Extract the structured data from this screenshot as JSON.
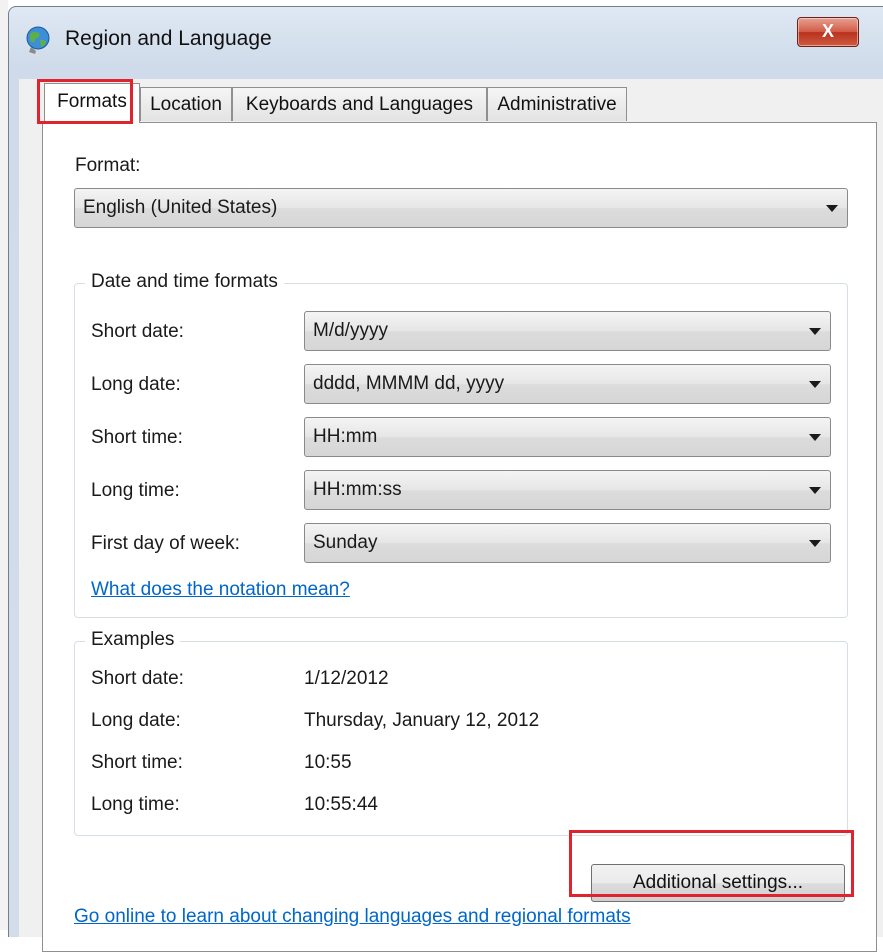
{
  "window": {
    "title": "Region and Language",
    "close_label": "X"
  },
  "tabs": [
    {
      "label": "Formats",
      "active": true
    },
    {
      "label": "Location"
    },
    {
      "label": "Keyboards and Languages"
    },
    {
      "label": "Administrative"
    }
  ],
  "format": {
    "label": "Format:",
    "value": "English (United States)"
  },
  "date_time": {
    "legend": "Date and time formats",
    "rows": [
      {
        "label": "Short date:",
        "value": "M/d/yyyy"
      },
      {
        "label": "Long date:",
        "value": "dddd, MMMM dd, yyyy"
      },
      {
        "label": "Short time:",
        "value": "HH:mm"
      },
      {
        "label": "Long time:",
        "value": "HH:mm:ss"
      },
      {
        "label": "First day of week:",
        "value": "Sunday"
      }
    ],
    "notation_link": "What does the notation mean?"
  },
  "examples": {
    "legend": "Examples",
    "rows": [
      {
        "label": "Short date:",
        "value": "1/12/2012"
      },
      {
        "label": "Long date:",
        "value": "Thursday, January 12, 2012"
      },
      {
        "label": "Short time:",
        "value": "10:55"
      },
      {
        "label": "Long time:",
        "value": "10:55:44"
      }
    ]
  },
  "additional_button": "Additional settings...",
  "online_link": "Go online to learn about changing languages and regional formats",
  "highlight_color": "#e0242f"
}
